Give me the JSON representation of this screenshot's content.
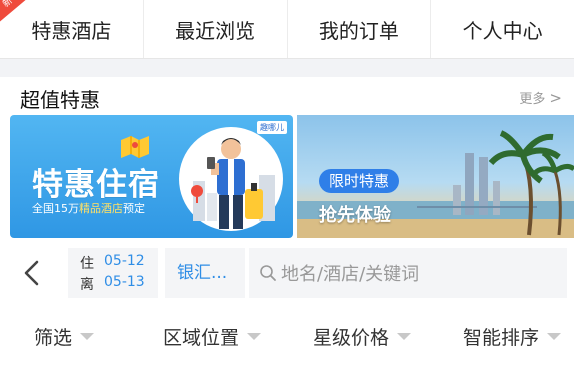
{
  "top_nav": {
    "items": [
      {
        "label": "特惠酒店"
      },
      {
        "label": "最近浏览"
      },
      {
        "label": "我的订单"
      },
      {
        "label": "个人中心"
      }
    ],
    "corner_badge": "新"
  },
  "deals_section": {
    "title": "超值特惠",
    "more_label": "更多",
    "more_arrow": ">"
  },
  "banners": {
    "left": {
      "title": "特惠住宿",
      "subtitle_prefix": "全国15万",
      "subtitle_highlight": "精品酒店",
      "subtitle_suffix": "预定",
      "brand": "趣哪儿"
    },
    "right": {
      "badge": "限时特惠",
      "text": "抢先体验"
    }
  },
  "search": {
    "checkin_label": "住",
    "checkin_date": "05-12",
    "checkout_label": "离",
    "checkout_date": "05-13",
    "city": "银汇...",
    "placeholder": "地名/酒店/关键词"
  },
  "filters": [
    {
      "label": "筛选"
    },
    {
      "label": "区域位置"
    },
    {
      "label": "星级价格"
    },
    {
      "label": "智能排序"
    }
  ],
  "colors": {
    "accent_blue": "#2e8de6",
    "banner_blue": "#3aa5ee",
    "ribbon_red": "#ef4b3c",
    "muted_gray": "#999999"
  }
}
